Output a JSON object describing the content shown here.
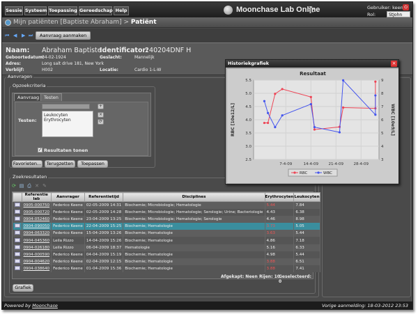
{
  "menu": [
    "Sessie",
    "Systeem",
    "Toepassing",
    "Gereedschap",
    "Help"
  ],
  "app_title": "Moonchase Lab Online",
  "user_label": "Gebruiker: keene",
  "role_label": "Rol:",
  "role_value": "StJohn",
  "breadcrumb": {
    "prefix": "Mijn patiënten [Baptiste Abraham] >",
    "current": "Patiënt"
  },
  "toolbar": {
    "add_request": "Aanvraag aanmaken"
  },
  "patient": {
    "name_label": "Naam:",
    "name": "Abraham Baptiste",
    "id_label": "Identificator:",
    "id": "240204DNF H",
    "dob_label": "Geboortedatum:",
    "dob": "04-02-1924",
    "gender_label": "Geslacht:",
    "gender": "Mannelijk",
    "address_label": "Adres:",
    "address": "Long salt drive 181, New York",
    "stay_label": "Verblijf:",
    "stay": "H002",
    "location_label": "Locatie:",
    "location": "Cardio 1-L-W"
  },
  "requests": {
    "legend": "Aanvragen",
    "criteria_legend": "Opzoekcriteria",
    "tabs": [
      "Aanvraag",
      "Testen"
    ],
    "tests_label": "Testen:",
    "tests": [
      "Leukocyten",
      "Erythrocyten"
    ],
    "show_results": "Resultaten tonen",
    "buttons": [
      "Favorieten...",
      "Terugzetten",
      "Toepassen"
    ]
  },
  "results": {
    "legend": "Zoekresultaten",
    "columns": [
      "",
      "Referentie lab",
      "Aanvrager",
      "Referentietijd",
      "Disciplines",
      "Erythrocyten",
      "Leukocyten"
    ],
    "rows": [
      {
        "ref": "0905-000750",
        "req": "Federico Keene",
        "time": "02-05-2009 14:31",
        "disc": "Biochemie; Microbiologie; Hematologie",
        "ery": "5.44",
        "leu": "7.84",
        "ery_red": true
      },
      {
        "ref": "0905-000720",
        "req": "Federico Keene",
        "time": "02-05-2009 14:28",
        "disc": "Biochemie; Microbiologie; Hematologie; Serologie; Urine; Bacteriologie",
        "ery": "4.43",
        "leu": "6.38",
        "ery_red": false
      },
      {
        "ref": "0904-052460",
        "req": "Federico Keene",
        "time": "23-04-2009 13:25",
        "disc": "Biochemie; Microbiologie; Hematologie; Serologie",
        "ery": "4.46",
        "leu": "8.98",
        "ery_red": false
      },
      {
        "ref": "0904-090050",
        "req": "Federico Keene",
        "time": "22-04-2009 15:25",
        "disc": "Biochemie; Hematologie",
        "ery": "3.73",
        "leu": "5.05",
        "ery_red": true,
        "selected": true
      },
      {
        "ref": "0904-063320",
        "req": "Federico Keene",
        "time": "15-04-2009 13:26",
        "disc": "Biochemie; Hematologie",
        "ery": "3.63",
        "leu": "5.44",
        "ery_red": true
      },
      {
        "ref": "0904-045360",
        "req": "Leila Rizzo",
        "time": "14-04-2009 15:26",
        "disc": "Biochemie; Hematologie",
        "ery": "4.86",
        "leu": "7.18",
        "ery_red": false
      },
      {
        "ref": "0904-026180",
        "req": "Leila Rizzo",
        "time": "06-04-2009 18:37",
        "disc": "Hematologie",
        "ery": "5.16",
        "leu": "6.33",
        "ery_red": false
      },
      {
        "ref": "0904-000590",
        "req": "Federico Keene",
        "time": "04-04-2009 15:19",
        "disc": "Biochemie; Hematologie",
        "ery": "4.98",
        "leu": "5.44",
        "ery_red": false
      },
      {
        "ref": "0904-004620",
        "req": "Federico Keene",
        "time": "02-04-2009 12:15",
        "disc": "Biochemie; Hematologie",
        "ery": "3.88",
        "leu": "6.51",
        "ery_red": true
      },
      {
        "ref": "0904-038640",
        "req": "Federico Keene",
        "time": "01-04-2009 15:36",
        "disc": "Biochemie; Hematologie",
        "ery": "3.88",
        "leu": "7.41",
        "ery_red": true
      }
    ],
    "footer": {
      "discarded": "Afgekapt: Neen",
      "rows": "Rijen: 10",
      "selected": "Geselecteerd: 0"
    },
    "graph_button": "Grafiek"
  },
  "footer": {
    "powered": "Powered by",
    "brand": "Moonchase",
    "last_login": "Vorige aanmelding: 18-03-2012 23:53"
  },
  "colors": {
    "rbc": "#ee4455",
    "wbc": "#4455ee"
  },
  "graph_window": {
    "title": "Historiekgrafiek",
    "close": "×"
  },
  "chart_data": {
    "type": "line",
    "title": "Resultaat",
    "ylabel": "RBC [10e12/L]",
    "y2label": "WBC [10e9/L]",
    "xticks": [
      "7-4-09",
      "14-4-09",
      "21-4-09",
      "28-4-09"
    ],
    "ylim": [
      2.5,
      5.5
    ],
    "y2lim": [
      3,
      9
    ],
    "yticks": [
      "2.5",
      "3.0",
      "3.5",
      "4.0",
      "4.5",
      "5.0",
      "5.5"
    ],
    "y2ticks": [
      "3",
      "4",
      "5",
      "6",
      "7",
      "8",
      "9"
    ],
    "x_dates": [
      "1-4-09",
      "2-4-09",
      "4-4-09",
      "6-4-09",
      "14-4-09",
      "15-4-09",
      "22-4-09",
      "23-4-09",
      "2-5-09",
      "2-5-09"
    ],
    "series": [
      {
        "name": "RBC",
        "values": [
          3.88,
          3.88,
          4.98,
          5.16,
          4.86,
          3.63,
          3.73,
          4.46,
          4.43,
          5.44
        ]
      },
      {
        "name": "WBC",
        "values": [
          7.41,
          6.51,
          5.44,
          6.33,
          7.18,
          5.44,
          5.05,
          8.98,
          6.38,
          7.84
        ]
      }
    ],
    "legend": "bottom"
  }
}
